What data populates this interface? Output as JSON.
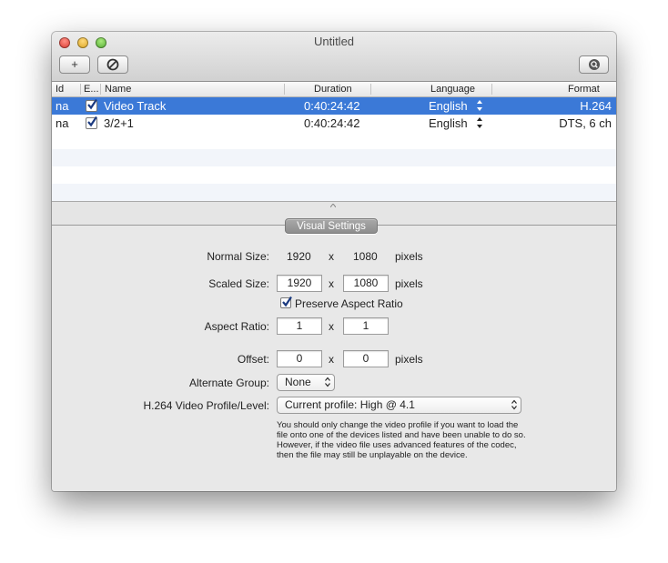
{
  "window": {
    "title": "Untitled"
  },
  "toolbar": {
    "add_label": "+",
    "remove_icon": "prohibited-icon",
    "search_icon": "magnifier-icon"
  },
  "table": {
    "columns": [
      "Id",
      "E...",
      "Name",
      "Duration",
      "Language",
      "Format"
    ],
    "rows": [
      {
        "id": "na",
        "enabled": true,
        "name": "Video Track",
        "duration": "0:40:24:42",
        "language": "English",
        "format": "H.264",
        "selected": true
      },
      {
        "id": "na",
        "enabled": true,
        "name": "3/2+1",
        "duration": "0:40:24:42",
        "language": "English",
        "format": "DTS, 6 ch",
        "selected": false
      }
    ]
  },
  "visual_settings": {
    "header": "Visual Settings",
    "normal_size_label": "Normal Size:",
    "normal_width": "1920",
    "normal_height": "1080",
    "x": "x",
    "pixels": "pixels",
    "scaled_size_label": "Scaled Size:",
    "scaled_width": "1920",
    "scaled_height": "1080",
    "preserve_aspect_label": "Preserve Aspect Ratio",
    "preserve_aspect_checked": true,
    "aspect_ratio_label": "Aspect Ratio:",
    "aspect_w": "1",
    "aspect_h": "1",
    "offset_label": "Offset:",
    "offset_x": "0",
    "offset_y": "0",
    "alternate_group_label": "Alternate Group:",
    "alternate_group_value": "None",
    "profile_label": "H.264 Video Profile/Level:",
    "profile_value": "Current profile: High @ 4.1",
    "note": "You should only change the video profile if you want to load the file onto one of the devices listed and have been unable to do so.  However, if the video file uses advanced features of the codec, then the file may still be unplayable on the device."
  },
  "colors": {
    "selection": "#3b79d7"
  }
}
